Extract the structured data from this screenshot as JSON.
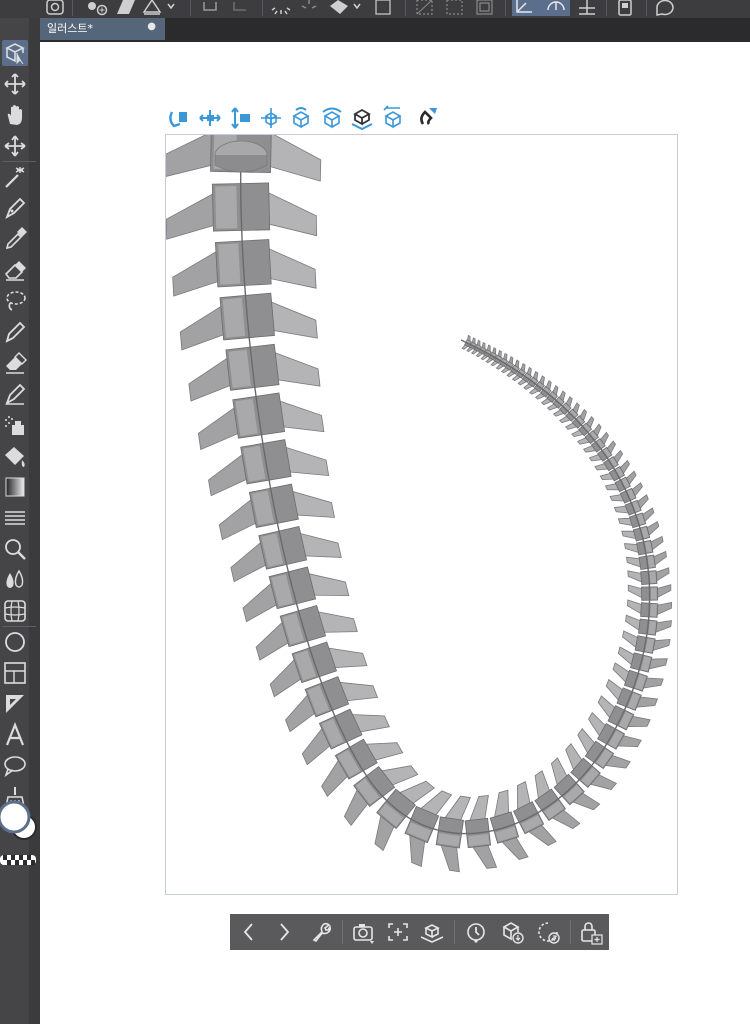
{
  "window": {
    "tab_title": "일러스트*",
    "tab_close_glyph": "●"
  },
  "top_command_bar": {
    "icons": [
      "clip-studio-icon",
      "new-layer-icon",
      "fill-icon",
      "tone-icon",
      "undo-icon",
      "redo-icon",
      "loading-spinner-icon",
      "transform-icon",
      "fill-bucket-icon",
      "selection-icon",
      "clear-selection-icon",
      "invert-selection-icon",
      "crop-icon",
      "ruler-icon",
      "ruler-active-icon",
      "snap-icon",
      "smartphone-icon",
      "help-icon"
    ]
  },
  "tools": [
    {
      "name": "object-tool",
      "icon": "object-cursor-icon",
      "active": true
    },
    {
      "name": "move-layer-tool",
      "icon": "move-icon",
      "active": false
    },
    {
      "name": "hand-tool",
      "icon": "hand-icon",
      "active": false
    },
    {
      "name": "move-tool",
      "icon": "move-arrows-icon",
      "active": false
    },
    {
      "name": "auto-select-tool",
      "icon": "magic-wand-icon",
      "active": false
    },
    {
      "name": "pen-tool",
      "icon": "pen-icon",
      "active": false
    },
    {
      "name": "eyedropper-tool",
      "icon": "eyedropper-icon",
      "active": false
    },
    {
      "name": "eraser-tool",
      "icon": "eraser-icon",
      "active": false
    },
    {
      "name": "lasso-tool",
      "icon": "lasso-icon",
      "active": false
    },
    {
      "name": "pencil-tool",
      "icon": "pencil-icon",
      "active": false
    },
    {
      "name": "soft-eraser-tool",
      "icon": "eraser-soft-icon",
      "active": false
    },
    {
      "name": "fine-pen-tool",
      "icon": "fine-pen-icon",
      "active": false
    },
    {
      "name": "airbrush-tool",
      "icon": "airbrush-icon",
      "active": false
    },
    {
      "name": "fill-tool",
      "icon": "paint-bucket-icon",
      "active": false
    },
    {
      "name": "gradient-tool",
      "icon": "gradient-icon",
      "active": false
    },
    {
      "name": "figure-tool",
      "icon": "lines-icon",
      "active": false
    },
    {
      "name": "zoom-tool",
      "icon": "magnifier-icon",
      "active": false
    },
    {
      "name": "blend-tool",
      "icon": "drops-icon",
      "active": false
    },
    {
      "name": "ruler-tool",
      "icon": "grid-ruler-icon",
      "active": false
    },
    {
      "name": "shape-tool",
      "icon": "circle-icon",
      "active": false
    },
    {
      "name": "frame-tool",
      "icon": "frame-border-icon",
      "active": false
    },
    {
      "name": "correct-line-tool",
      "icon": "triangle-ruler-icon",
      "active": false
    },
    {
      "name": "text-tool",
      "icon": "text-a-icon",
      "active": false
    },
    {
      "name": "balloon-tool",
      "icon": "speech-balloon-icon",
      "active": false
    },
    {
      "name": "sweep-tool",
      "icon": "broom-icon",
      "active": false
    }
  ],
  "colors": {
    "main_color": "#ffffff",
    "sub_color": "#ffffff",
    "active_tool_bg": "#5b6f8c",
    "launcher_icon": "#3a98d8",
    "spine": "#8e8e90"
  },
  "object_launcher": {
    "icons": [
      "rotate-camera-icon",
      "pan-camera-icon",
      "dolly-camera-icon",
      "move-object-xy-icon",
      "rotate-object-icon",
      "rotate-object-z-icon",
      "align-floor-icon",
      "reset-position-icon",
      "magnet-snap-icon"
    ]
  },
  "camera_bar": {
    "icons": [
      "previous-icon",
      "next-icon",
      "wrench-settings-icon",
      "camera-angle-icon",
      "fit-to-screen-icon",
      "floor-align-icon",
      "timeline-icon",
      "save-pose-icon",
      "reset-rotation-icon",
      "lock-object-icon"
    ]
  }
}
